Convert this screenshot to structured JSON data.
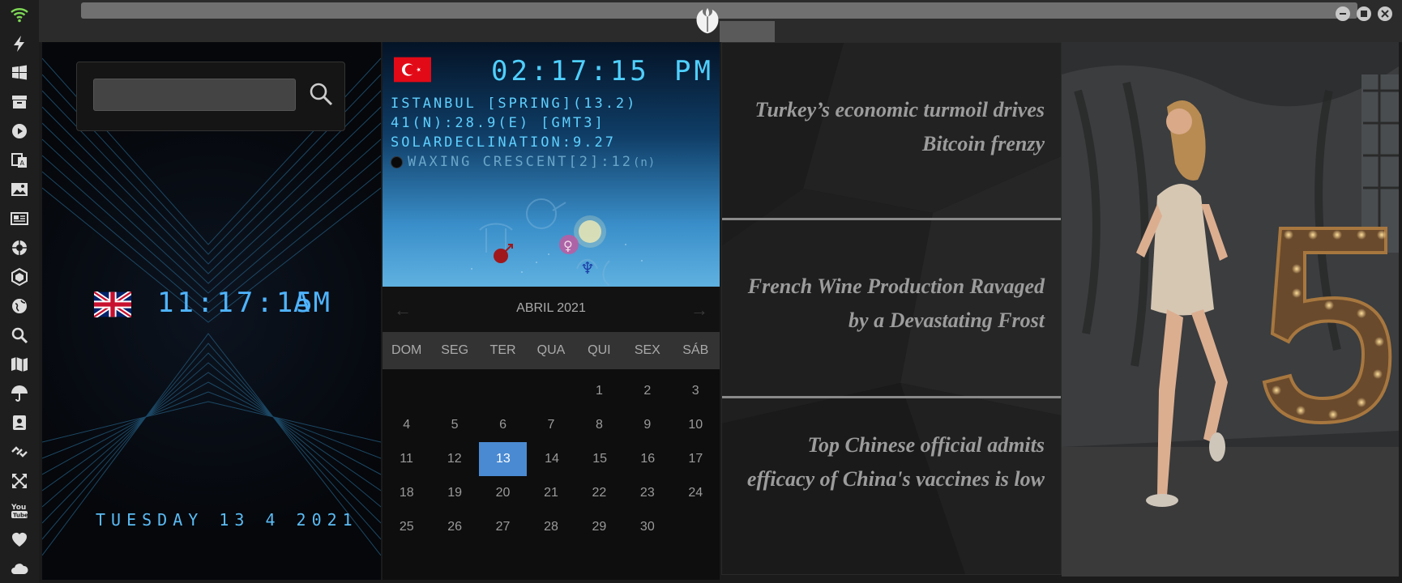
{
  "window": {
    "title_field": "",
    "controls": [
      "minimize",
      "maximize",
      "close"
    ]
  },
  "sidebar": {
    "icons": [
      "wifi-icon",
      "bolt-icon",
      "windows-icon",
      "archive-icon",
      "play-icon",
      "translate-icon",
      "image-icon",
      "newspaper-icon",
      "aperture-icon",
      "hexagon-icon",
      "globe-icon",
      "search-icon",
      "map-icon",
      "umbrella-icon",
      "contacts-icon",
      "link-icon",
      "fullscreen-icon",
      "youtube-icon",
      "heart-icon",
      "cloud-icon"
    ]
  },
  "search": {
    "value": "",
    "placeholder": ""
  },
  "local_clock": {
    "country": "United Kingdom",
    "time": "11:17:15",
    "ampm": "AM",
    "date": "TUESDAY 13 4 2021"
  },
  "world_clock": {
    "country": "Turkey",
    "time": "02:17:15",
    "ampm": "PM",
    "line1": "ISTANBUL [SPRING](13.2)",
    "line2": "41(N):28.9(E) [GMT3]",
    "line3": "SOLARDECLINATION:9.27",
    "moon": "WAXING CRESCENT[2]:12",
    "moon_suffix": "(n)"
  },
  "calendar": {
    "month": "ABRIL 2021",
    "prev": "←",
    "next": "→",
    "weekdays": [
      "DOM",
      "SEG",
      "TER",
      "QUA",
      "QUI",
      "SEX",
      "SÁB"
    ],
    "weeks": [
      [
        "",
        "",
        "",
        "",
        "1",
        "2",
        "3"
      ],
      [
        "4",
        "5",
        "6",
        "7",
        "8",
        "9",
        "10"
      ],
      [
        "11",
        "12",
        "13",
        "14",
        "15",
        "16",
        "17"
      ],
      [
        "18",
        "19",
        "20",
        "21",
        "22",
        "23",
        "24"
      ],
      [
        "25",
        "26",
        "27",
        "28",
        "29",
        "30",
        ""
      ]
    ],
    "today": "13"
  },
  "news": {
    "items": [
      "Turkey’s economic turmoil drives Bitcoin frenzy",
      "French Wine Production Ravaged by a Devastating Frost",
      "Top Chinese official admits efficacy of China's vaccines is low"
    ]
  },
  "colors": {
    "accent_lcd": "#4fb4ff",
    "calendar_today": "#4a8ad2",
    "wifi": "#7ed957"
  }
}
